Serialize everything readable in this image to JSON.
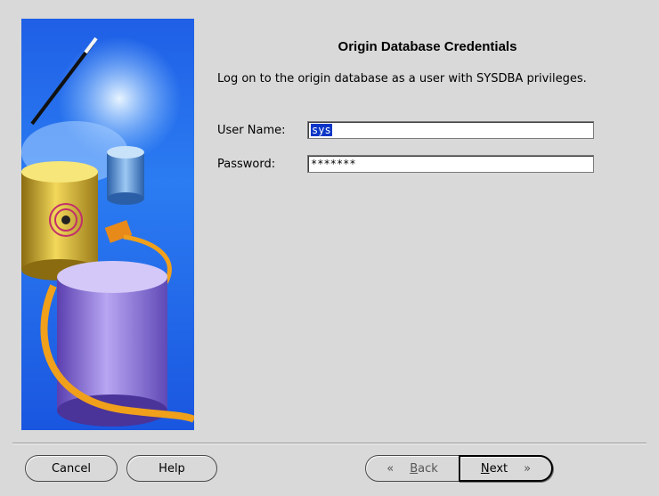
{
  "dialog": {
    "title": "Origin Database Credentials",
    "instruction": "Log on to the origin database as a user with SYSDBA privileges."
  },
  "form": {
    "username_label": "User Name:",
    "username_value": "sys",
    "password_label": "Password:",
    "password_value": "*******"
  },
  "buttons": {
    "cancel": "Cancel",
    "help": "Help",
    "back_mnemonic": "B",
    "back_rest": "ack",
    "back_icon": "«",
    "next_mnemonic": "N",
    "next_rest": "ext",
    "next_icon": "»"
  },
  "colors": {
    "background": "#d9d9d9",
    "selection": "#0a36c7",
    "banner_blue": "#1f5fe6"
  }
}
